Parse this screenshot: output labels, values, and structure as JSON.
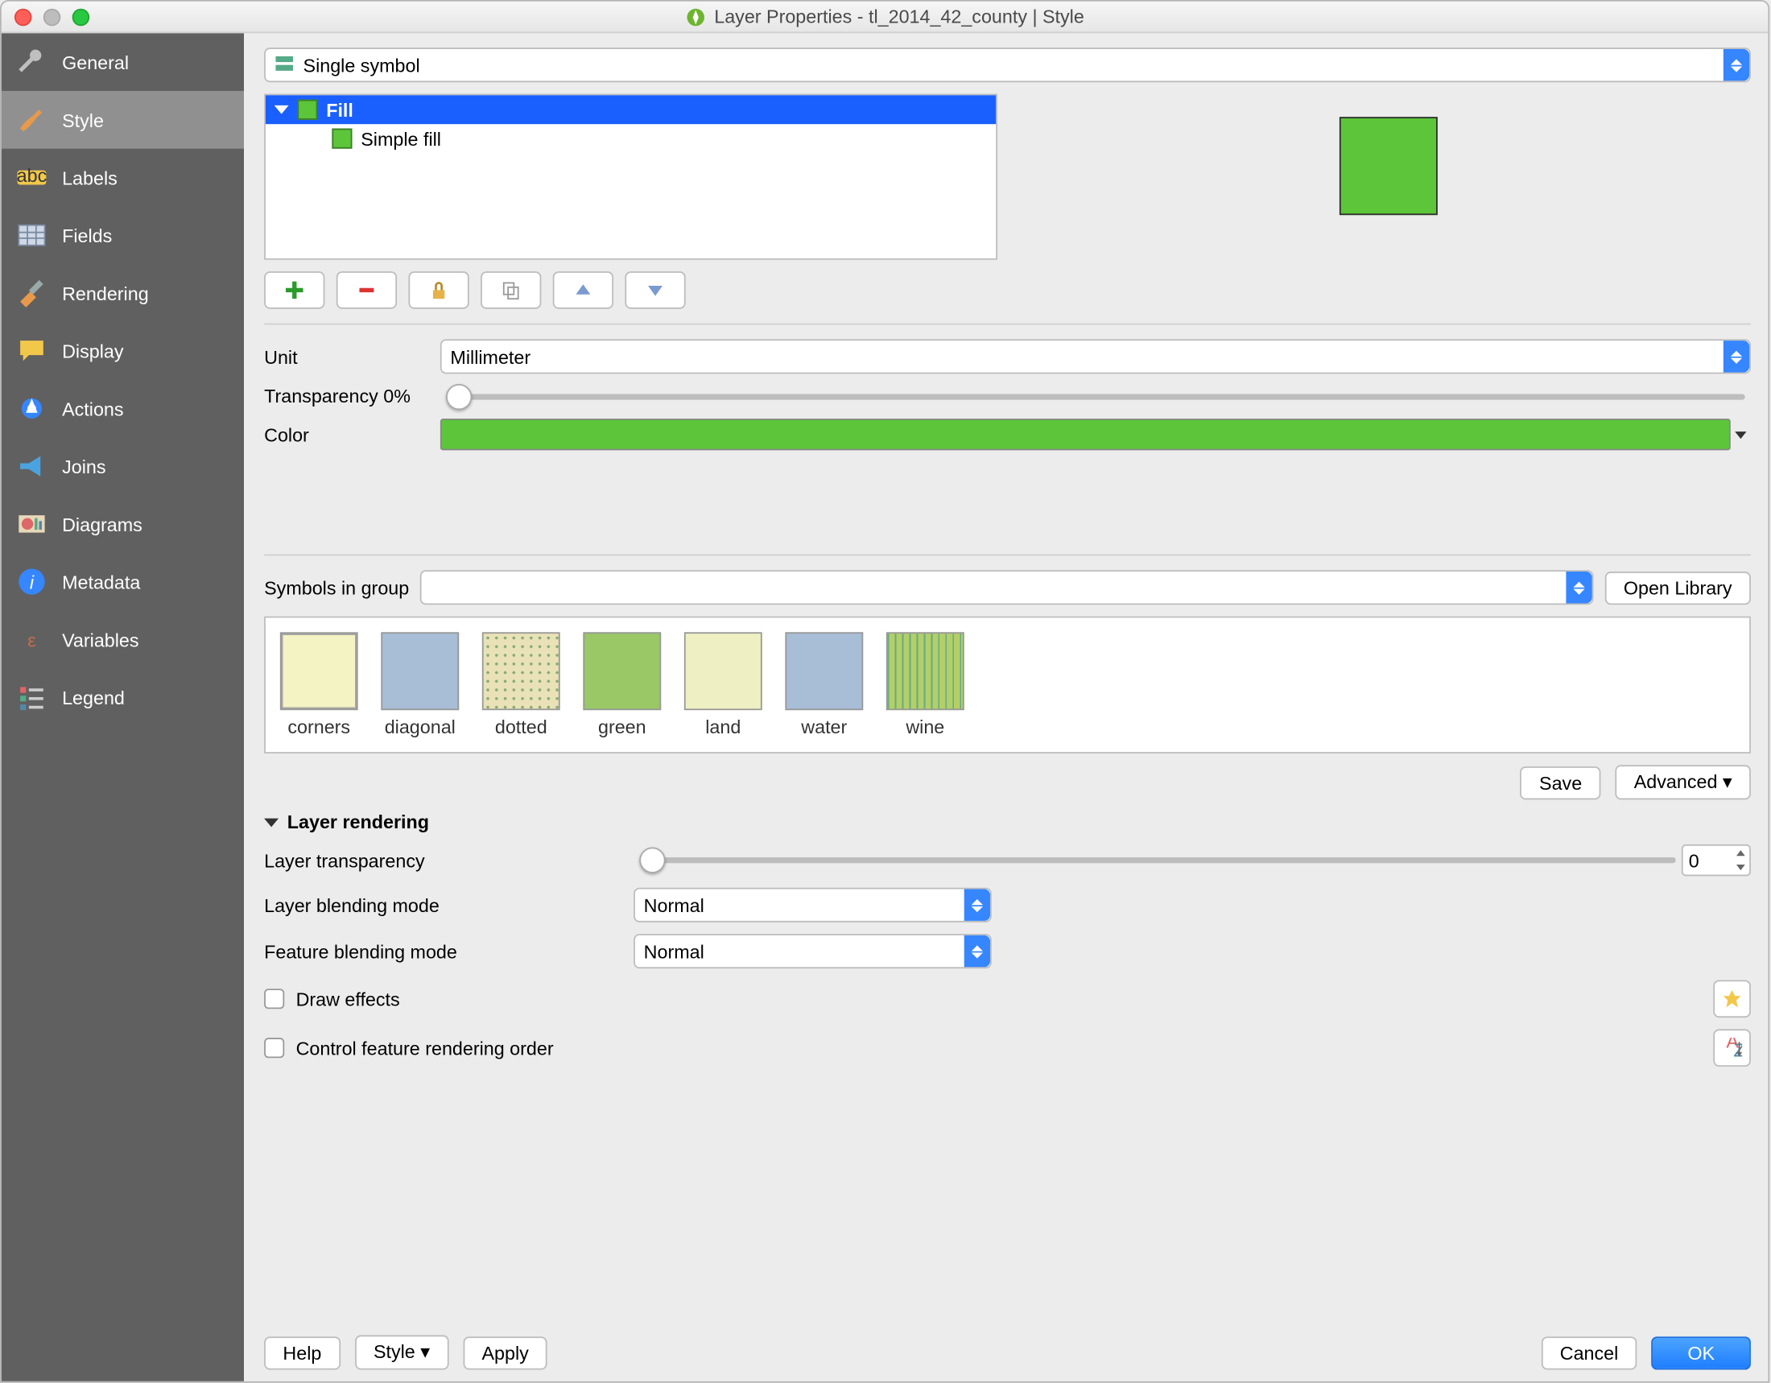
{
  "title": "Layer Properties - tl_2014_42_county | Style",
  "sidebar": {
    "items": [
      {
        "label": "General"
      },
      {
        "label": "Style"
      },
      {
        "label": "Labels"
      },
      {
        "label": "Fields"
      },
      {
        "label": "Rendering"
      },
      {
        "label": "Display"
      },
      {
        "label": "Actions"
      },
      {
        "label": "Joins"
      },
      {
        "label": "Diagrams"
      },
      {
        "label": "Metadata"
      },
      {
        "label": "Variables"
      },
      {
        "label": "Legend"
      }
    ],
    "active": 1
  },
  "symbolMode": "Single symbol",
  "tree": {
    "root": "Fill",
    "child": "Simple fill"
  },
  "unit": {
    "label": "Unit",
    "value": "Millimeter"
  },
  "transparency": {
    "label": "Transparency 0%"
  },
  "color": {
    "label": "Color",
    "hex": "#5cc53a"
  },
  "symbolsInGroup": {
    "label": "Symbols in group"
  },
  "openLibrary": "Open Library",
  "symbols": [
    {
      "name": "corners",
      "bg": "#f4f3c4",
      "extra": "corners"
    },
    {
      "name": "diagonal",
      "bg": "#a8bdd6"
    },
    {
      "name": "dotted",
      "bg": "#e9e2b6",
      "extra": "dotted"
    },
    {
      "name": "green",
      "bg": "#9ac866"
    },
    {
      "name": "land",
      "bg": "#eef0c4"
    },
    {
      "name": "water",
      "bg": "#a8bdd6"
    },
    {
      "name": "wine",
      "bg": "#b3cf68",
      "extra": "wine"
    }
  ],
  "save": "Save",
  "advanced": "Advanced ▾",
  "layerRendering": {
    "header": "Layer rendering",
    "transparency": {
      "label": "Layer transparency",
      "value": "0"
    },
    "layerBlend": {
      "label": "Layer blending mode",
      "value": "Normal"
    },
    "featureBlend": {
      "label": "Feature blending mode",
      "value": "Normal"
    },
    "drawEffects": "Draw effects",
    "controlOrder": "Control feature rendering order"
  },
  "footer": {
    "help": "Help",
    "style": "Style ▾",
    "apply": "Apply",
    "cancel": "Cancel",
    "ok": "OK"
  }
}
